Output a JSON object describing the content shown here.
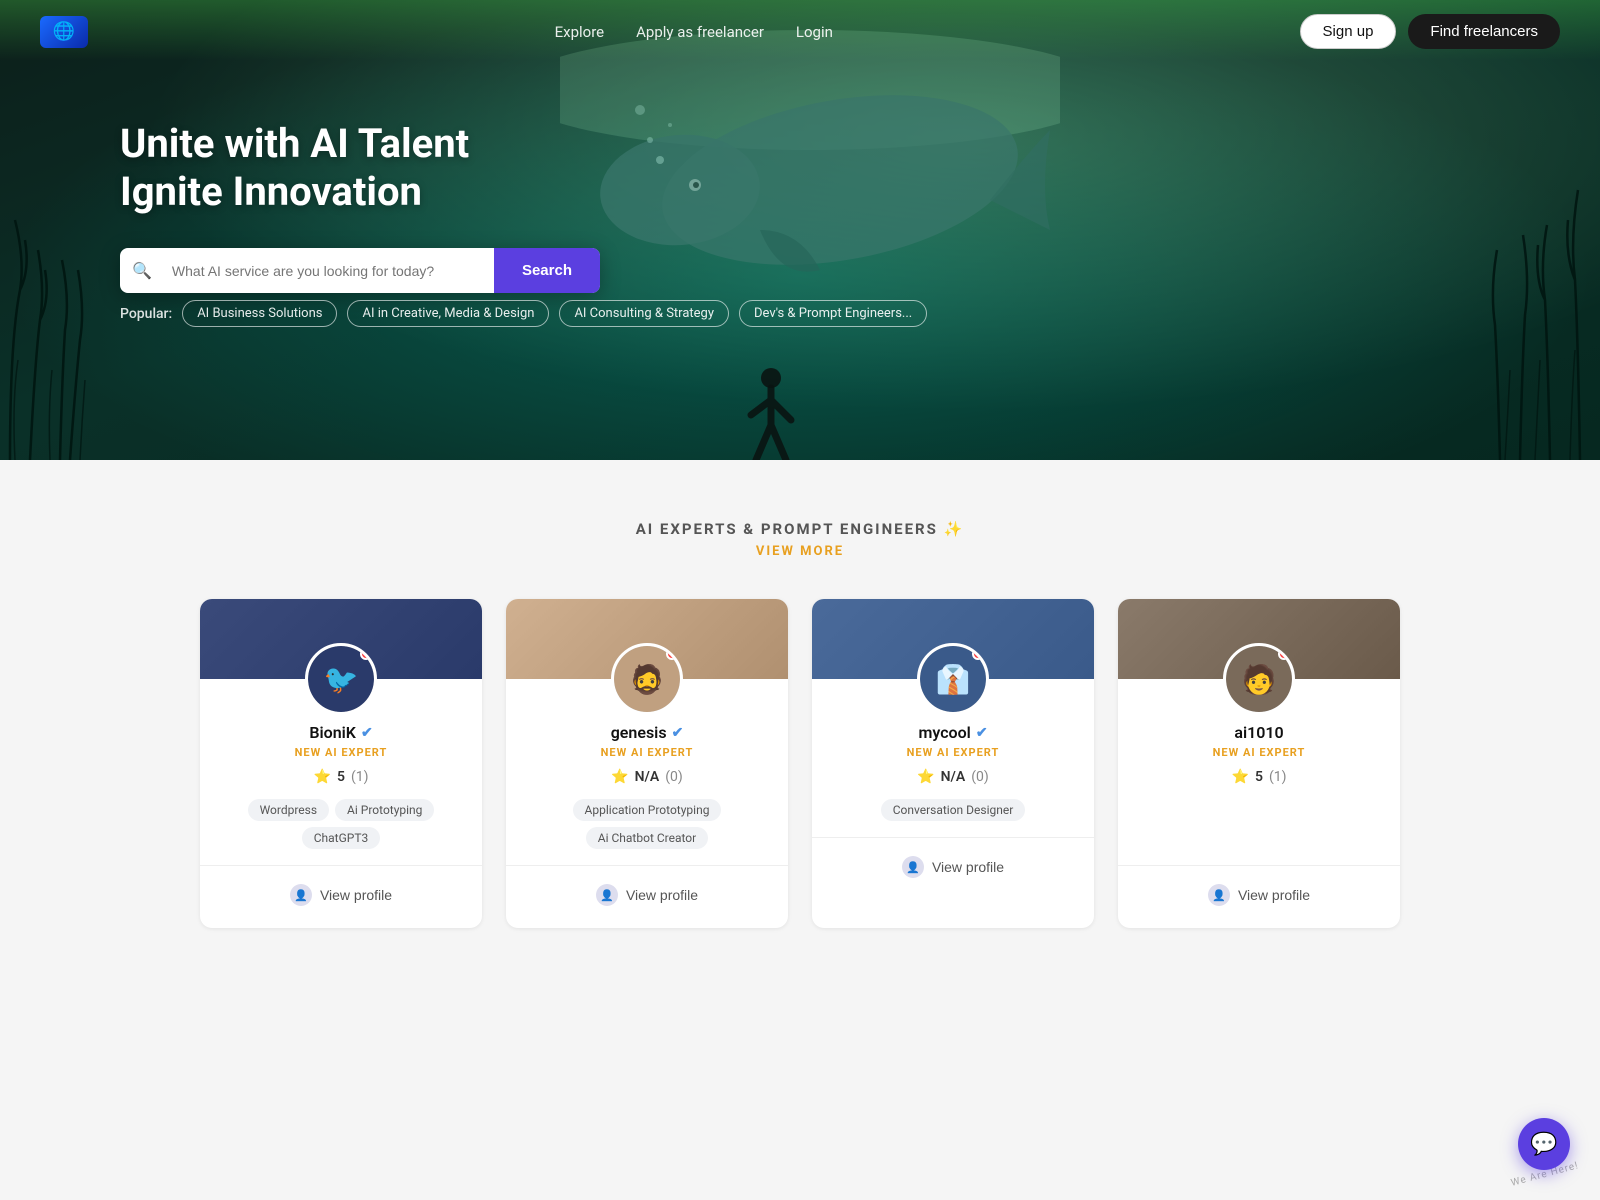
{
  "nav": {
    "logo_icon": "🌐",
    "links": [
      {
        "label": "Explore",
        "id": "explore"
      },
      {
        "label": "Apply as freelancer",
        "id": "apply"
      },
      {
        "label": "Login",
        "id": "login"
      }
    ],
    "signup_label": "Sign up",
    "find_label": "Find freelancers"
  },
  "hero": {
    "title_line1": "Unite with AI Talent",
    "title_line2": "Ignite Innovation",
    "search_placeholder": "What AI service are you looking for today?",
    "search_button": "Search",
    "popular_label": "Popular:",
    "tags": [
      {
        "label": "AI Business Solutions",
        "id": "tag-business"
      },
      {
        "label": "AI in Creative, Media & Design",
        "id": "tag-creative"
      },
      {
        "label": "AI Consulting & Strategy",
        "id": "tag-consulting"
      },
      {
        "label": "Dev's & Prompt Engineers...",
        "id": "tag-devs"
      }
    ]
  },
  "experts_section": {
    "title": "AI EXPERTS & PROMPT ENGINEERS ✨",
    "view_more": "VIEW MORE"
  },
  "freelancers": [
    {
      "id": "bioniK",
      "name": "BioniK",
      "verified": true,
      "badge": "NEW AI EXPERT",
      "rating": "5",
      "rating_count": "1",
      "avatar_letter": "🐦",
      "avatar_bg": "#2a3a6a",
      "tags": [
        "Wordpress",
        "Ai Prototyping",
        "ChatGPT3"
      ],
      "online": true,
      "view_profile": "View profile"
    },
    {
      "id": "genesis",
      "name": "genesis",
      "verified": true,
      "badge": "NEW AI EXPERT",
      "rating": "N/A",
      "rating_count": "0",
      "avatar_letter": "👤",
      "avatar_bg": "#c0a080",
      "tags": [
        "Application Prototyping",
        "Ai Chatbot Creator"
      ],
      "online": true,
      "view_profile": "View profile"
    },
    {
      "id": "mycool",
      "name": "mycool",
      "verified": true,
      "badge": "NEW AI EXPERT",
      "rating": "N/A",
      "rating_count": "0",
      "avatar_letter": "👤",
      "avatar_bg": "#3a5a8a",
      "tags": [
        "Conversation Designer"
      ],
      "online": true,
      "view_profile": "View profile"
    },
    {
      "id": "ai1010",
      "name": "ai1010",
      "verified": false,
      "badge": "NEW AI EXPERT",
      "rating": "5",
      "rating_count": "1",
      "avatar_letter": "👤",
      "avatar_bg": "#7a6a5a",
      "tags": [],
      "online": true,
      "view_profile": "View profile"
    }
  ],
  "chat": {
    "label": "💬",
    "we_are_here": "We Are Here!"
  }
}
